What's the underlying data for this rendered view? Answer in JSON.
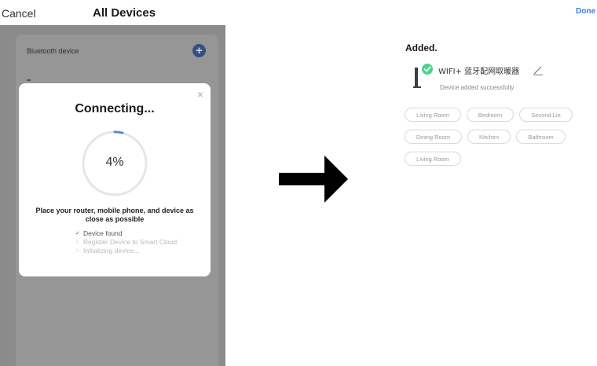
{
  "left_screen": {
    "header": {
      "cancel_label": "Cancel",
      "title": "All Devices"
    },
    "list": {
      "bluetooth_label": "Bluetooth device",
      "add_icon": "plus-circle-icon"
    },
    "modal": {
      "close_icon": "×",
      "title": "Connecting...",
      "progress_percent": 4,
      "progress_label": "4%",
      "instruction": "Place your router, mobile phone, and device as close as possible",
      "steps": [
        {
          "mark": "✓",
          "label": "Device found",
          "status": "done"
        },
        {
          "mark": "○",
          "label": "Register Device to Smart Cloud",
          "status": "pending"
        },
        {
          "mark": "○",
          "label": "Initializing device...",
          "status": "pending"
        }
      ]
    }
  },
  "arrow_icon": "right-arrow-icon",
  "right_screen": {
    "done_label": "Done",
    "added_title": "Added.",
    "device": {
      "name": "WIFI+ 蓝牙配网取暖器",
      "status": "Device added successfully",
      "icon": "heater-device-icon",
      "check_icon": "check-circle-icon",
      "edit_icon": "pencil-icon"
    },
    "rooms": [
      "Living Room",
      "Bedroom",
      "Second Lie",
      "Dining Room",
      "Kitchen",
      "Bathroom",
      "Living Room"
    ]
  },
  "colors": {
    "accent_blue": "#3f7bd9",
    "success_green": "#4cd28a",
    "overlay_gray": "#8b8b8b",
    "progress_blue": "#5b8bd6"
  }
}
